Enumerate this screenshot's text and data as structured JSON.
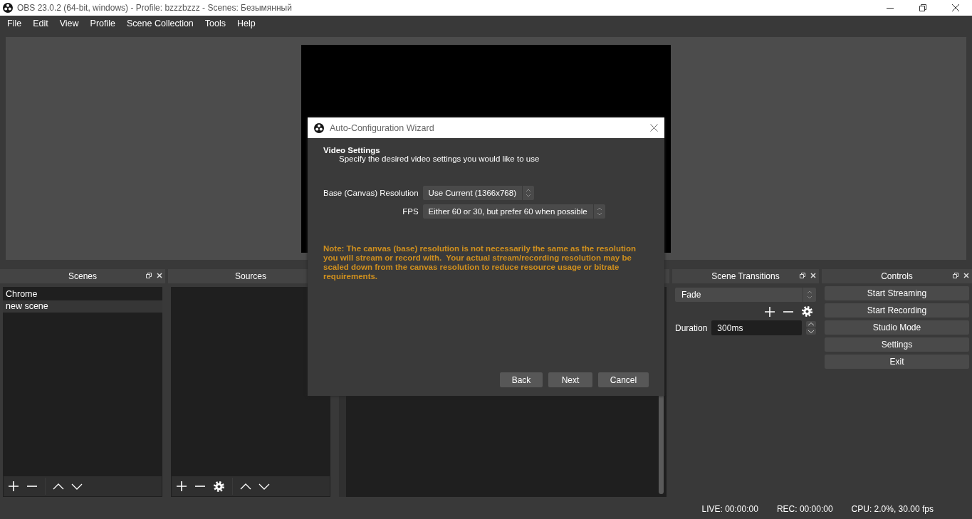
{
  "window": {
    "title": "OBS 23.0.2 (64-bit, windows) - Profile: bzzzbzzz - Scenes: Безымянный"
  },
  "menu": [
    "File",
    "Edit",
    "View",
    "Profile",
    "Scene Collection",
    "Tools",
    "Help"
  ],
  "scenes_dock": {
    "title": "Scenes",
    "items": [
      {
        "label": "Chrome",
        "selected": false
      },
      {
        "label": "new scene",
        "selected": true
      }
    ]
  },
  "sources_dock": {
    "title": "Sources"
  },
  "transitions_dock": {
    "title": "Scene Transitions",
    "transition": "Fade",
    "duration_label": "Duration",
    "duration": "300ms"
  },
  "controls_dock": {
    "title": "Controls",
    "buttons": [
      "Start Streaming",
      "Start Recording",
      "Studio Mode",
      "Settings",
      "Exit"
    ]
  },
  "status_bar": {
    "live": "LIVE: 00:00:00",
    "rec": "REC: 00:00:00",
    "cpu": "CPU: 2.0%, 30.00 fps"
  },
  "dialog": {
    "title": "Auto-Configuration Wizard",
    "heading": "Video Settings",
    "subheading": "Specify the desired video settings you would like to use",
    "fields": [
      {
        "label": "Base (Canvas) Resolution",
        "value": "Use Current (1366x768)"
      },
      {
        "label": "FPS",
        "value": "Either 60 or 30, but prefer 60 when possible"
      }
    ],
    "note": "Note: The canvas (base) resolution is not necessarily the same as the resolution you will stream or record with.  Your actual stream/recording resolution may be scaled down from the canvas resolution to reduce resource usage or bitrate requirements.",
    "buttons": [
      "Back",
      "Next",
      "Cancel"
    ]
  }
}
